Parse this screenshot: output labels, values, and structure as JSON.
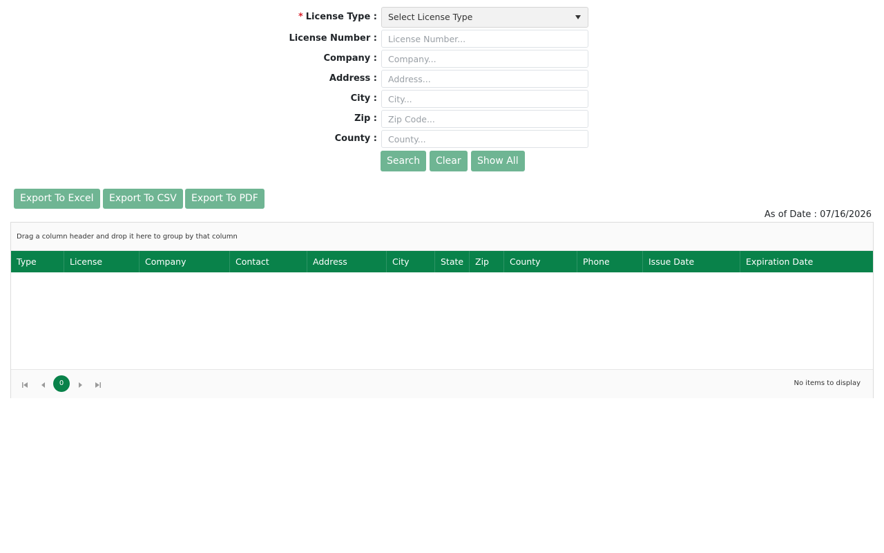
{
  "form": {
    "license_type": {
      "label": "License Type :",
      "required_marker": "*",
      "value": "Select License Type"
    },
    "license_number": {
      "label": "License Number :",
      "placeholder": "License Number..."
    },
    "company": {
      "label": "Company :",
      "placeholder": "Company..."
    },
    "address": {
      "label": "Address :",
      "placeholder": "Address..."
    },
    "city": {
      "label": "City :",
      "placeholder": "City..."
    },
    "zip": {
      "label": "Zip :",
      "placeholder": "Zip Code..."
    },
    "county": {
      "label": "County :",
      "placeholder": "County..."
    },
    "buttons": {
      "search": "Search",
      "clear": "Clear",
      "show_all": "Show All"
    }
  },
  "exports": {
    "excel": "Export To Excel",
    "csv": "Export To CSV",
    "pdf": "Export To PDF"
  },
  "as_of": "As of Date : 07/16/2026",
  "grid": {
    "group_hint": "Drag a column header and drop it here to group by that column",
    "columns": [
      "Type",
      "License",
      "Company",
      "Contact",
      "Address",
      "City",
      "State",
      "Zip",
      "County",
      "Phone",
      "Issue Date",
      "Expiration Date"
    ],
    "rows": [],
    "pager": {
      "current_page": "0",
      "info": "No items to display"
    }
  },
  "colors": {
    "primary_green": "#09824a",
    "button_green": "#6fb593",
    "required_red": "#d9232d"
  },
  "icons": {
    "select_caret": "caret-down-icon",
    "pager_first": "first-page-icon",
    "pager_prev": "prev-page-icon",
    "pager_next": "next-page-icon",
    "pager_last": "last-page-icon"
  }
}
